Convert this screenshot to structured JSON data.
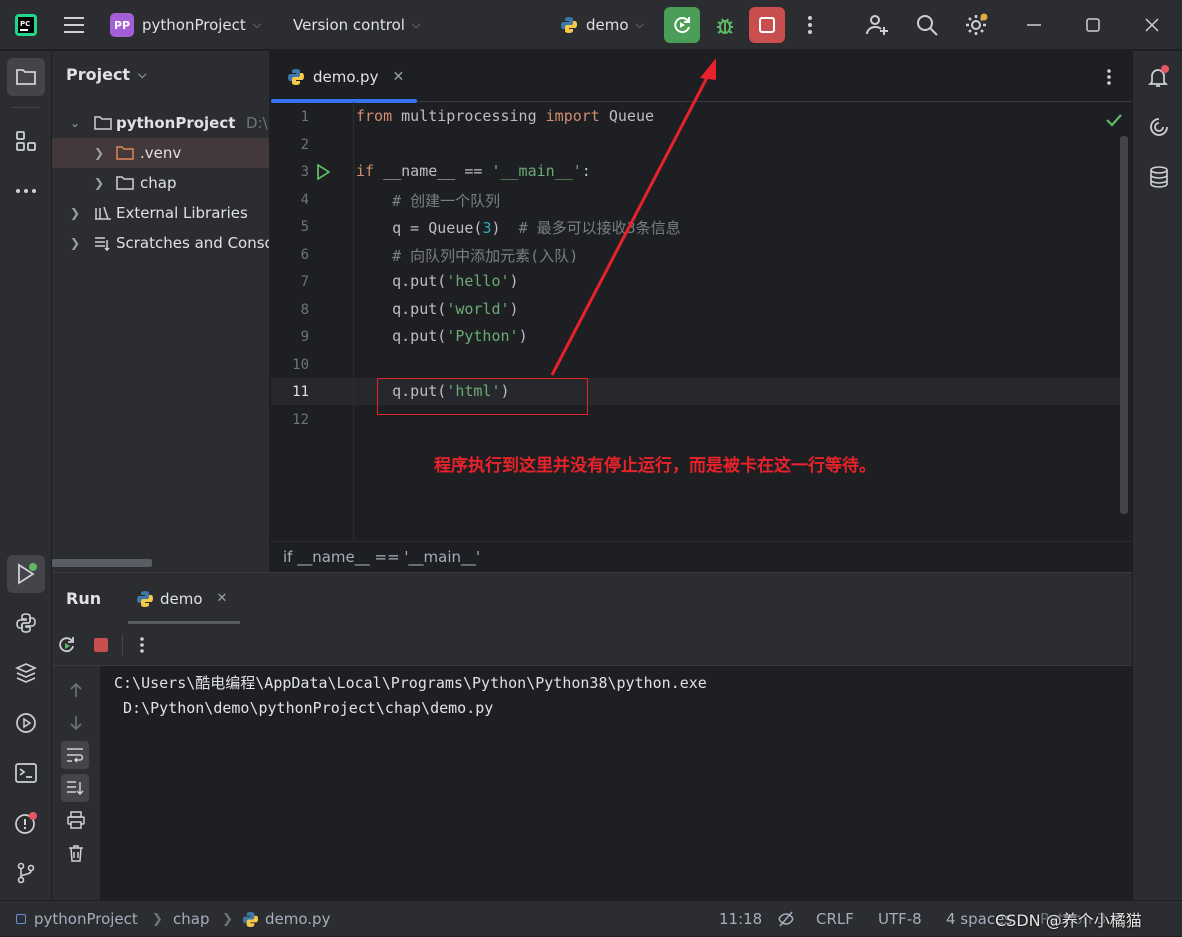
{
  "titlebar": {
    "project_badge": "PP",
    "project_name": "pythonProject",
    "version_control": "Version control",
    "run_config": "demo"
  },
  "colors": {
    "run_green": "#4a9e57",
    "stop_red": "#c94f4f",
    "annotation_red": "#e8222a",
    "badge_purple": "#a45fd6"
  },
  "project_panel": {
    "title": "Project",
    "items": [
      {
        "label": "pythonProject",
        "suffix": "D:\\"
      },
      {
        "label": ".venv"
      },
      {
        "label": "chap"
      },
      {
        "label": "External Libraries"
      },
      {
        "label": "Scratches and Consoles"
      }
    ]
  },
  "editor": {
    "tab_label": "demo.py",
    "line_numbers": [
      "1",
      "2",
      "3",
      "4",
      "5",
      "6",
      "7",
      "8",
      "9",
      "10",
      "11",
      "12"
    ],
    "breadcrumb": "if __name__ == '__main__'"
  },
  "code": {
    "l1_from": "from",
    "l1_mod": " multiprocessing ",
    "l1_import": "import",
    "l1_name": " Queue",
    "l3_if": "if",
    "l3_a": " __name__ == ",
    "l3_str": "'__main__'",
    "l3_b": ":",
    "l4": "    # 创建一个队列",
    "l5_a": "    q = Queue(",
    "l5_num": "3",
    "l5_b": ")  ",
    "l5_cm": "# 最多可以接收3条信息",
    "l6": "    # 向队列中添加元素(入队)",
    "l7_a": "    q.put(",
    "l7_str": "'hello'",
    "l7_b": ")",
    "l8_a": "    q.put(",
    "l8_str": "'world'",
    "l8_b": ")",
    "l9_a": "    q.put(",
    "l9_str": "'Python'",
    "l9_b": ")",
    "l11_a": "    q.put(",
    "l11_str": "'html'",
    "l11_b": ")"
  },
  "annotation": {
    "text": "程序执行到这里并没有停止运行，而是被卡在这一行等待。"
  },
  "run_panel": {
    "title": "Run",
    "tab_label": "demo",
    "console_lines": [
      "C:\\Users\\酷电编程\\AppData\\Local\\Programs\\Python\\Python38\\python.exe",
      " D:\\Python\\demo\\pythonProject\\chap\\demo.py"
    ]
  },
  "statusbar": {
    "crumbs": [
      "pythonProject",
      "chap",
      "demo.py"
    ],
    "position": "11:18",
    "line_sep": "CRLF",
    "encoding": "UTF-8",
    "indent": "4 spaces",
    "interpreter": "Python 3.8",
    "watermark": "CSDN @养个小橘猫"
  }
}
